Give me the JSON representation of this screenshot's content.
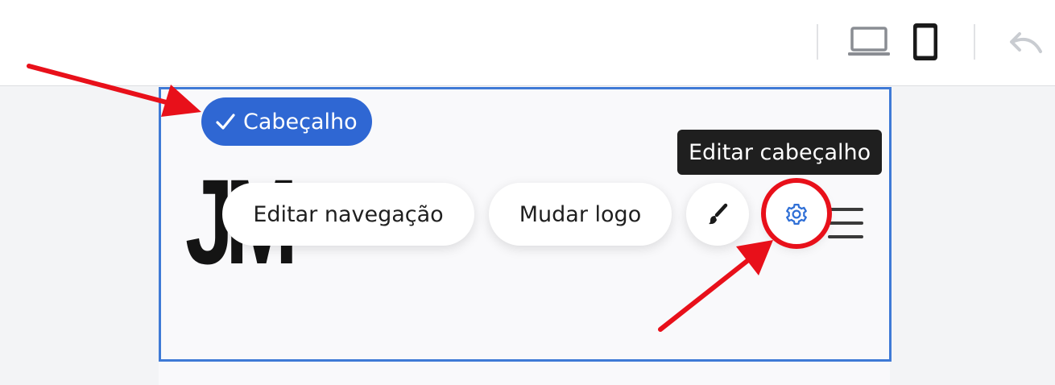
{
  "toolbar": {
    "desktop_icon": "laptop-icon",
    "mobile_icon": "smartphone-icon",
    "undo_icon": "undo-icon"
  },
  "section_badge": {
    "label": "Cabeçalho",
    "icon": "check-icon",
    "color": "#2f67d3"
  },
  "header": {
    "logo_text": "JM",
    "actions": {
      "edit_navigation": "Editar navegação",
      "change_logo": "Mudar logo",
      "style_icon": "brush-icon",
      "settings_icon": "gear-icon",
      "menu_icon": "hamburger-icon"
    },
    "tooltip": "Editar cabeçalho"
  },
  "annotations": {
    "color": "#e8101a"
  },
  "colors": {
    "accent": "#3f7ad6",
    "settings_icon": "#2f6fd6",
    "tooltip_bg": "#1f1f1f"
  }
}
